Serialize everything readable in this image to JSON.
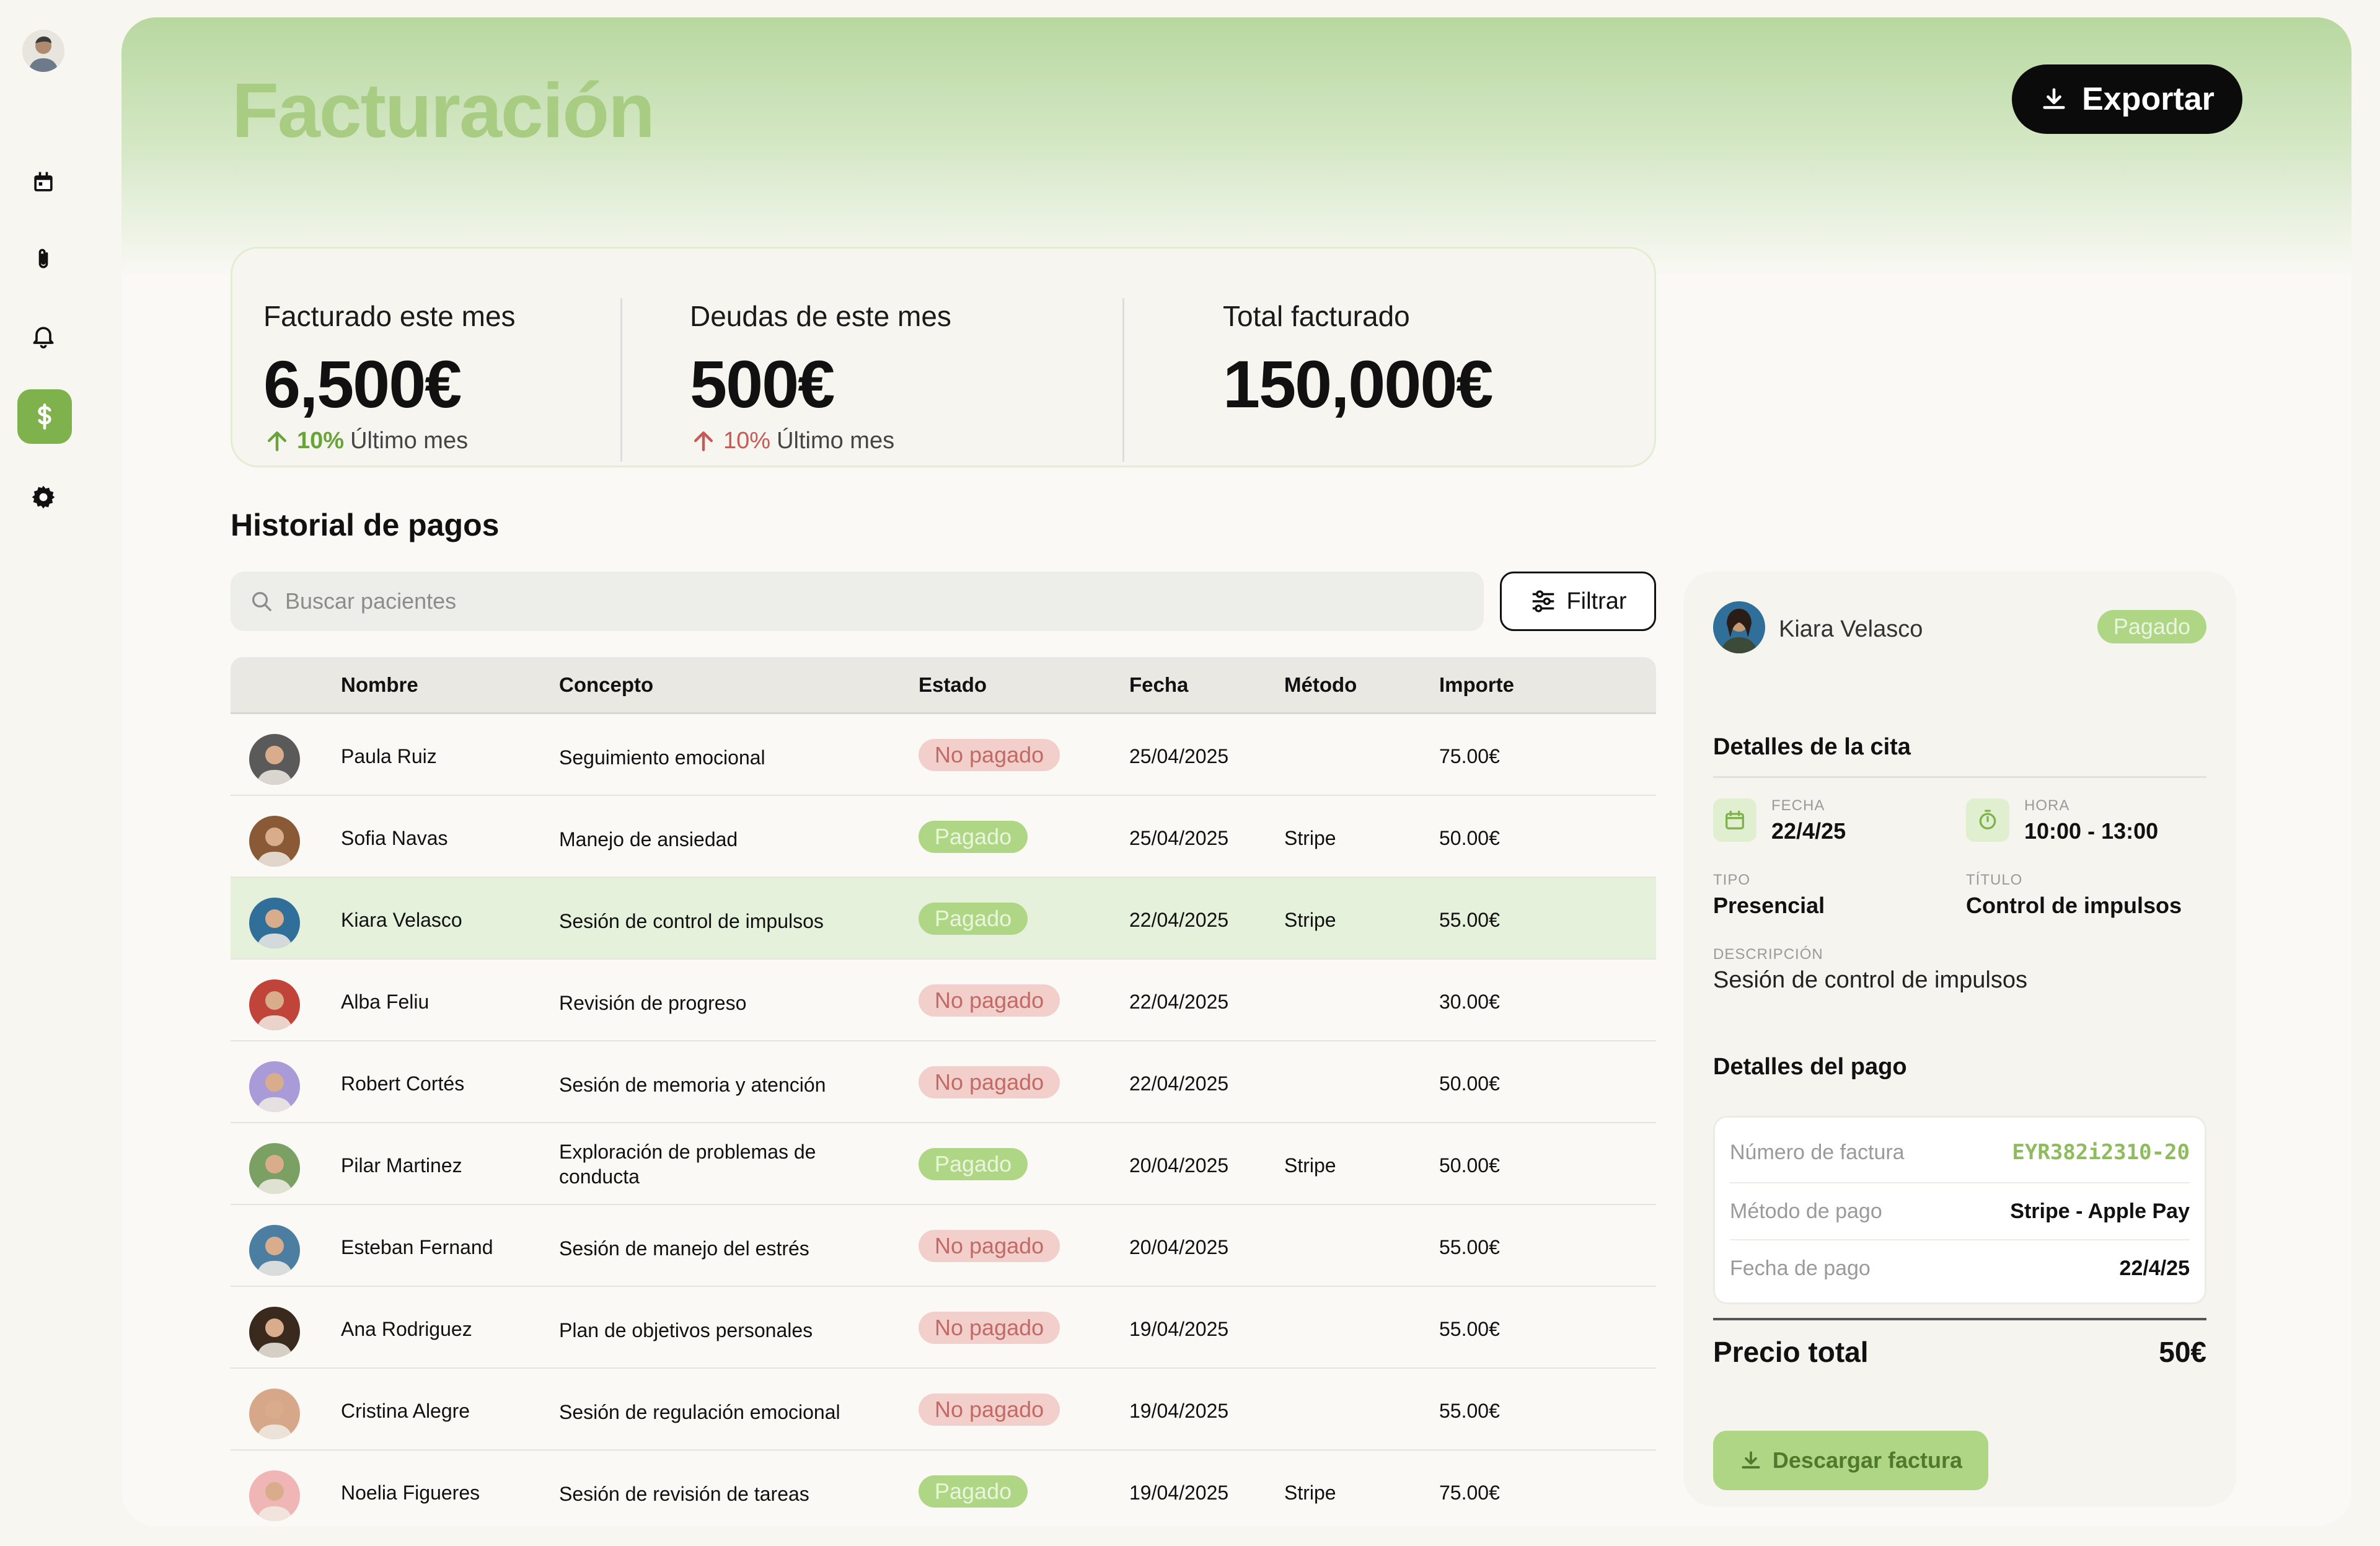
{
  "page": {
    "title": "Facturación",
    "export_label": "Exportar"
  },
  "sidebar": {
    "items": [
      {
        "name": "calendar",
        "icon": "calendar-icon"
      },
      {
        "name": "attachments",
        "icon": "paperclip-icon"
      },
      {
        "name": "notifications",
        "icon": "bell-icon"
      },
      {
        "name": "billing",
        "icon": "dollar-icon",
        "active": true
      },
      {
        "name": "settings",
        "icon": "gear-icon"
      }
    ]
  },
  "stats": [
    {
      "label": "Facturado este mes",
      "value": "6,500€",
      "pct": "10%",
      "pct_label": "Último mes",
      "trend": "good"
    },
    {
      "label": "Deudas de este mes",
      "value": "500€",
      "pct": "10%",
      "pct_label": "Último mes",
      "trend": "bad"
    },
    {
      "label": "Total facturado",
      "value": "150,000€"
    }
  ],
  "history": {
    "title": "Historial de pagos",
    "search_placeholder": "Buscar pacientes",
    "filter_label": "Filtrar",
    "columns": [
      "Nombre",
      "Concepto",
      "Estado",
      "Fecha",
      "Método",
      "Importe"
    ],
    "rows": [
      {
        "name": "Paula Ruiz",
        "concept": "Seguimiento emocional",
        "status": "No pagado",
        "date": "25/04/2025",
        "method": "",
        "amount": "75.00€",
        "avatar_color": "#5a5a5a"
      },
      {
        "name": "Sofia Navas",
        "concept": "Manejo de ansiedad",
        "status": "Pagado",
        "date": "25/04/2025",
        "method": "Stripe",
        "amount": "50.00€",
        "avatar_color": "#8a5a36"
      },
      {
        "name": "Kiara Velasco",
        "concept": "Sesión de control de impulsos",
        "status": "Pagado",
        "date": "22/04/2025",
        "method": "Stripe",
        "amount": "55.00€",
        "avatar_color": "#2f6f9a",
        "selected": true
      },
      {
        "name": "Alba Feliu",
        "concept": "Revisión de progreso",
        "status": "No pagado",
        "date": "22/04/2025",
        "method": "",
        "amount": "30.00€",
        "avatar_color": "#c0443a"
      },
      {
        "name": "Robert Cortés",
        "concept": "Sesión de memoria y atención",
        "status": "No pagado",
        "date": "22/04/2025",
        "method": "",
        "amount": "50.00€",
        "avatar_color": "#a99ad8"
      },
      {
        "name": "Pilar Martinez",
        "concept": "Exploración de problemas de conducta",
        "status": "Pagado",
        "date": "20/04/2025",
        "method": "Stripe",
        "amount": "50.00€",
        "avatar_color": "#7aa064"
      },
      {
        "name": "Esteban Fernand",
        "concept": "Sesión de manejo del estrés",
        "status": "No pagado",
        "date": "20/04/2025",
        "method": "",
        "amount": "55.00€",
        "avatar_color": "#4b7ea0"
      },
      {
        "name": "Ana Rodriguez",
        "concept": "Plan de objetivos personales",
        "status": "No pagado",
        "date": "19/04/2025",
        "method": "",
        "amount": "55.00€",
        "avatar_color": "#3a2a1e"
      },
      {
        "name": "Cristina Alegre",
        "concept": "Sesión de regulación emocional",
        "status": "No pagado",
        "date": "19/04/2025",
        "method": "",
        "amount": "55.00€",
        "avatar_color": "#d7a78a"
      },
      {
        "name": "Noelia Figueres",
        "concept": "Sesión de revisión de tareas",
        "status": "Pagado",
        "date": "19/04/2025",
        "method": "Stripe",
        "amount": "75.00€",
        "avatar_color": "#f0b5b5"
      }
    ]
  },
  "detail": {
    "name": "Kiara Velasco",
    "status": "Pagado",
    "appointment_title": "Detalles de la cita",
    "fecha_cap": "FECHA",
    "fecha": "22/4/25",
    "hora_cap": "HORA",
    "hora": "10:00 - 13:00",
    "tipo_cap": "TIPO",
    "tipo": "Presencial",
    "titulo_cap": "TÍTULO",
    "titulo": "Control de impulsos",
    "desc_cap": "DESCRIPCIÓN",
    "desc": "Sesión de control de impulsos",
    "payment_title": "Detalles del pago",
    "payment": [
      {
        "k": "Número de factura",
        "v": "EYR382i2310-20"
      },
      {
        "k": "Método de pago",
        "v": "Stripe - Apple Pay"
      },
      {
        "k": "Fecha de pago",
        "v": "22/4/25"
      }
    ],
    "total_label": "Precio total",
    "total": "50€",
    "download_label": "Descargar factura"
  },
  "colors": {
    "accent": "#7fb24c",
    "paid": "#aed685",
    "unpaid": "#f2cfcb",
    "selected_row": "#e5f1da"
  }
}
